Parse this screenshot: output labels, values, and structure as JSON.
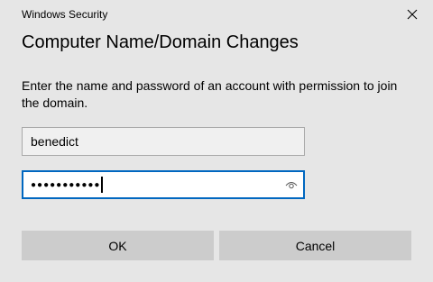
{
  "window": {
    "app_title": "Windows Security",
    "close_icon": "close-icon"
  },
  "dialog": {
    "heading": "Computer Name/Domain Changes",
    "description": "Enter the name and password of an account with permission to join the domain."
  },
  "form": {
    "username_value": "benedict",
    "password_mask": "●●●●●●●●●●●",
    "reveal_icon": "eye-icon"
  },
  "buttons": {
    "ok_label": "OK",
    "cancel_label": "Cancel"
  },
  "colors": {
    "background": "#e6e6e6",
    "focus_border": "#0067c0",
    "button_bg": "#cccccc"
  }
}
